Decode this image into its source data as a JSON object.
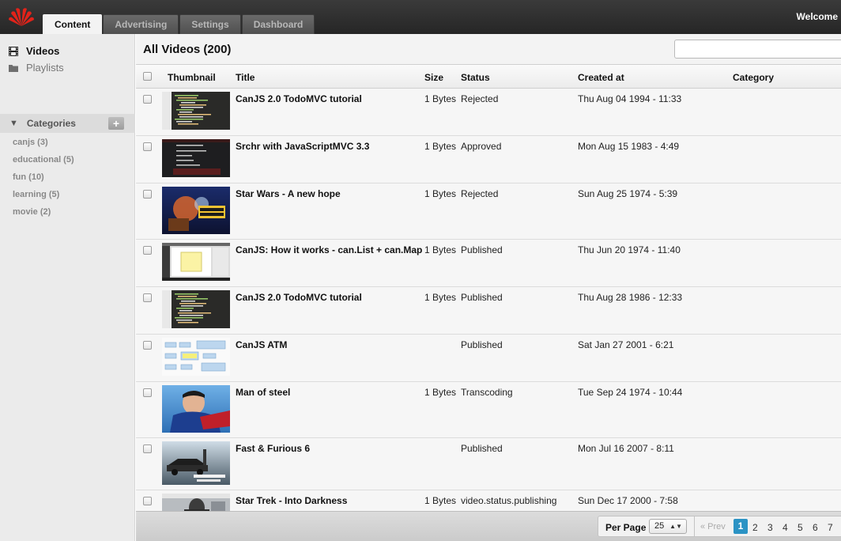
{
  "header": {
    "tabs": [
      {
        "label": "Content",
        "active": true
      },
      {
        "label": "Advertising",
        "active": false
      },
      {
        "label": "Settings",
        "active": false
      },
      {
        "label": "Dashboard",
        "active": false
      }
    ],
    "welcome": "Welcome",
    "logo_icon": "huawei-logo",
    "brand_color": "#e2231a"
  },
  "sidebar": {
    "nav": [
      {
        "label": "Videos",
        "icon": "film-icon",
        "active": true
      },
      {
        "label": "Playlists",
        "icon": "folder-icon",
        "active": false
      }
    ],
    "categories_label": "Categories",
    "categories": [
      {
        "label": "canjs (3)"
      },
      {
        "label": "educational (5)"
      },
      {
        "label": "fun (10)"
      },
      {
        "label": "learning (5)"
      },
      {
        "label": "movie (2)"
      }
    ]
  },
  "main": {
    "title": "All Videos (200)",
    "search": {
      "value": "",
      "placeholder": ""
    },
    "columns": {
      "thumbnail": "Thumbnail",
      "title": "Title",
      "size": "Size",
      "status": "Status",
      "created": "Created at",
      "category": "Category"
    },
    "rows": [
      {
        "title": "CanJS 2.0 TodoMVC tutorial",
        "size": "1 Bytes",
        "status": "Rejected",
        "created": "Thu Aug 04 1994 - 11:33",
        "category": "",
        "thumb": "code"
      },
      {
        "title": "Srchr with JavaScriptMVC 3.3",
        "size": "1 Bytes",
        "status": "Approved",
        "created": "Mon Aug 15 1983 - 4:49",
        "category": "",
        "thumb": "list"
      },
      {
        "title": "Star Wars - A new hope",
        "size": "1 Bytes",
        "status": "Rejected",
        "created": "Sun Aug 25 1974 - 5:39",
        "category": "",
        "thumb": "starwars"
      },
      {
        "title": "CanJS: How it works - can.List + can.Map",
        "size": "1 Bytes",
        "status": "Published",
        "created": "Thu Jun 20 1974 - 11:40",
        "category": "",
        "thumb": "screen"
      },
      {
        "title": "CanJS 2.0 TodoMVC tutorial",
        "size": "1 Bytes",
        "status": "Published",
        "created": "Thu Aug 28 1986 - 12:33",
        "category": "",
        "thumb": "code"
      },
      {
        "title": "CanJS ATM",
        "size": "",
        "status": "Published",
        "created": "Sat Jan 27 2001 - 6:21",
        "category": "",
        "thumb": "diagram"
      },
      {
        "title": "Man of steel",
        "size": "1 Bytes",
        "status": "Transcoding",
        "created": "Tue Sep 24 1974 - 10:44",
        "category": "",
        "thumb": "superman"
      },
      {
        "title": "Fast & Furious 6",
        "size": "",
        "status": "Published",
        "created": "Mon Jul 16 2007 - 8:11",
        "category": "",
        "thumb": "fastfurious"
      },
      {
        "title": "Star Trek - Into Darkness",
        "size": "1 Bytes",
        "status": "video.status.publishing",
        "created": "Sun Dec 17 2000 - 7:58",
        "category": "",
        "thumb": "startrek"
      }
    ]
  },
  "footer": {
    "per_page_label": "Per Page",
    "per_page_value": "25",
    "prev_label": "« Prev",
    "pages": [
      "1",
      "2",
      "3",
      "4",
      "5",
      "6",
      "7"
    ],
    "current_page": "1"
  }
}
